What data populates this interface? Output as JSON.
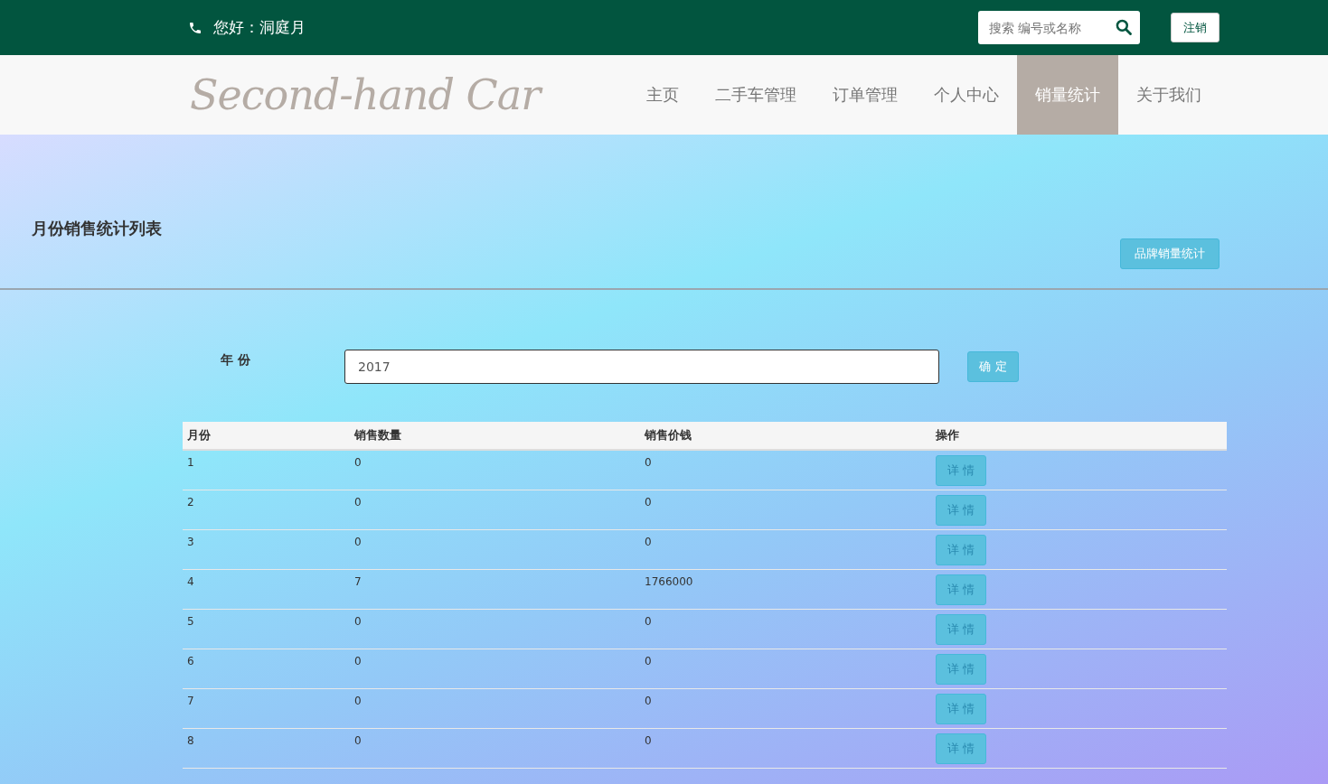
{
  "top_bar": {
    "greeting": "您好：洞庭月",
    "search": {
      "placeholder": "搜索 编号或名称"
    },
    "logout": "注销"
  },
  "nav": {
    "logo": "Second-hand Car",
    "items": [
      {
        "label": "主页",
        "selected": false
      },
      {
        "label": "二手车管理",
        "selected": false
      },
      {
        "label": "订单管理",
        "selected": false
      },
      {
        "label": "个人中心",
        "selected": false
      },
      {
        "label": "销量统计",
        "selected": true
      },
      {
        "label": "关于我们",
        "selected": false
      }
    ]
  },
  "page": {
    "title": "月份销售统计列表",
    "brand_button": "品牌销量统计"
  },
  "filter": {
    "label": "年 份",
    "value": "2017",
    "confirm": "确 定"
  },
  "table": {
    "columns": [
      "月份",
      "销售数量",
      "销售价钱",
      "操作"
    ],
    "rows": [
      {
        "month": "1",
        "count": "0",
        "amount": "0",
        "action": "详 情"
      },
      {
        "month": "2",
        "count": "0",
        "amount": "0",
        "action": "详 情"
      },
      {
        "month": "3",
        "count": "0",
        "amount": "0",
        "action": "详 情"
      },
      {
        "month": "4",
        "count": "7",
        "amount": "1766000",
        "action": "详 情"
      },
      {
        "month": "5",
        "count": "0",
        "amount": "0",
        "action": "详 情"
      },
      {
        "month": "6",
        "count": "0",
        "amount": "0",
        "action": "详 情"
      },
      {
        "month": "7",
        "count": "0",
        "amount": "0",
        "action": "详 情"
      },
      {
        "month": "8",
        "count": "0",
        "amount": "0",
        "action": "详 情"
      }
    ]
  }
}
